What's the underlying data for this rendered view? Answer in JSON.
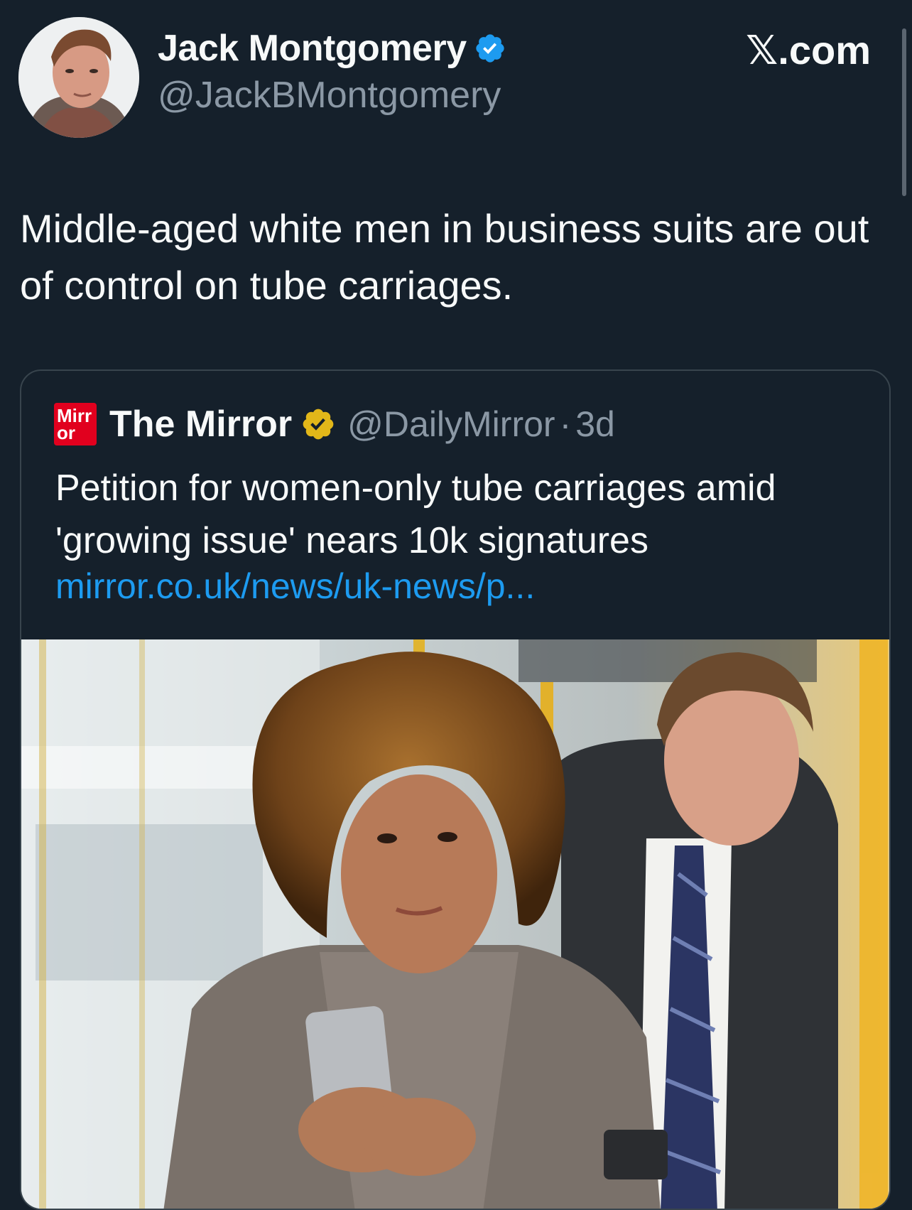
{
  "author": {
    "name": "Jack Montgomery",
    "handle": "@JackBMontgomery",
    "verified": true,
    "verified_color": "#1d9bf0"
  },
  "watermark": {
    "prefix": "𝕏",
    "suffix": ".com"
  },
  "tweet": {
    "text": "Middle-aged white men in business suits are out of control on tube carriages."
  },
  "quoted_tweet": {
    "logo_line1": "Mirr",
    "logo_line2": "or",
    "name": "The Mirror",
    "verified_color": "#e2a500",
    "handle": "@DailyMirror",
    "separator": "·",
    "time": "3d",
    "text": "Petition for women-only tube carriages amid 'growing issue' nears 10k signatures",
    "link": "mirror.co.uk/news/uk-news/p..."
  },
  "colors": {
    "background": "#15202b",
    "border": "#38444d",
    "secondary_text": "#8b98a5",
    "link": "#1d9bf0",
    "mirror_red": "#e1001e"
  }
}
